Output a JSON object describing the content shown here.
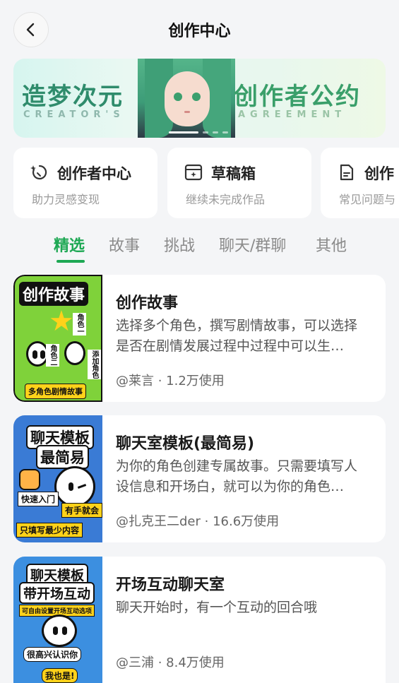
{
  "header": {
    "title": "创作中心"
  },
  "banner": {
    "left_title": "造梦次元",
    "left_sub": "CREATOR'S",
    "right_title": "创作者公约",
    "right_sub": "AGREEMENT",
    "page_dots": 4,
    "active_dot": 1
  },
  "quick_entries": [
    {
      "title": "创作者中心",
      "subtitle": "助力灵感变现",
      "icon": "creator-spark-icon"
    },
    {
      "title": "草稿箱",
      "subtitle": "继续未完成作品",
      "icon": "draft-box-icon"
    },
    {
      "title": "创作",
      "subtitle": "常见问题与",
      "icon": "document-icon"
    }
  ],
  "tabs": [
    {
      "label": "精选",
      "active": true
    },
    {
      "label": "故事",
      "active": false
    },
    {
      "label": "挑战",
      "active": false
    },
    {
      "label": "聊天/群聊",
      "active": false
    },
    {
      "label": "其他",
      "active": false
    }
  ],
  "items": [
    {
      "title": "创作故事",
      "description": "选择多个角色，撰写剧情故事，可以选择是否在剧情发展过程中过程中可以生…",
      "meta": "@莱言 · 1.2万使用",
      "thumb": {
        "headline": "创作故事",
        "tags": [
          "角色一",
          "角色二",
          "添加角色"
        ],
        "footer": "多角色剧情故事",
        "bg": "#7fd23a"
      }
    },
    {
      "title": "聊天室模板(最简易)",
      "description": "为你的角色创建专属故事。只需要填写人设信息和开场白，就可以为你的角色…",
      "meta": "@扎克王二der · 16.6万使用",
      "thumb": {
        "headline1": "聊天模板",
        "headline2": "最简易",
        "tags": [
          "快速入门",
          "有手就会",
          "只填写最少内容"
        ],
        "bg": "#3a7bd5"
      }
    },
    {
      "title": "开场互动聊天室",
      "description": "聊天开始时，有一个互动的回合哦",
      "meta": "@三浦 · 8.4万使用",
      "thumb": {
        "headline1": "聊天模板",
        "headline2": "带开场互动",
        "banner": "可自由设置开场互动选项",
        "tags": [
          "很高兴认识你",
          "我也是!"
        ],
        "bg": "#3c8fe0"
      }
    }
  ],
  "colors": {
    "accent": "#1ea854",
    "background": "#f4f5f7",
    "card": "#ffffff"
  }
}
